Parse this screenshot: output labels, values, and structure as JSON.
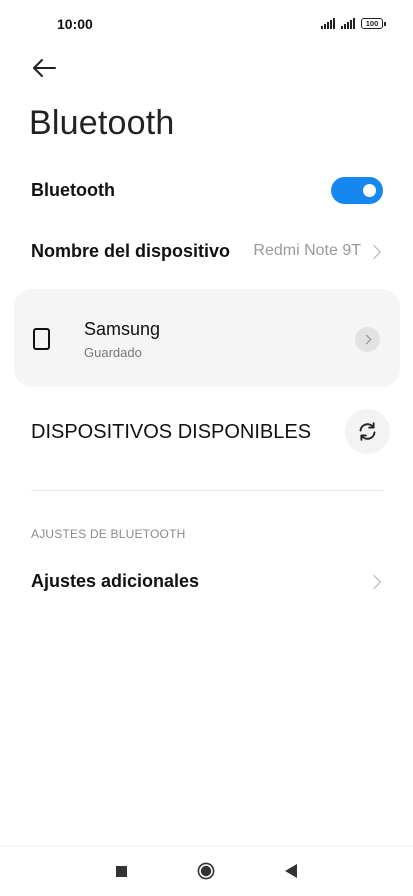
{
  "status_bar": {
    "time": "10:00",
    "battery": "100"
  },
  "header": {
    "title": "Bluetooth"
  },
  "bluetooth_toggle": {
    "label": "Bluetooth",
    "enabled": true,
    "accent_color": "#1787f0"
  },
  "device_name_row": {
    "label": "Nombre del dispositivo",
    "value": "Redmi Note 9T"
  },
  "paired_devices": [
    {
      "name": "Samsung",
      "status": "Guardado",
      "icon": "phone-icon"
    }
  ],
  "available_devices": {
    "heading": "DISPOSITIVOS DISPONIBLES",
    "refresh_icon": "refresh-icon"
  },
  "settings_section": {
    "caption": "AJUSTES DE BLUETOOTH",
    "additional_label": "Ajustes adicionales"
  },
  "nav_bar": {
    "icons": [
      "recent-apps-icon",
      "home-icon",
      "back-icon"
    ]
  }
}
